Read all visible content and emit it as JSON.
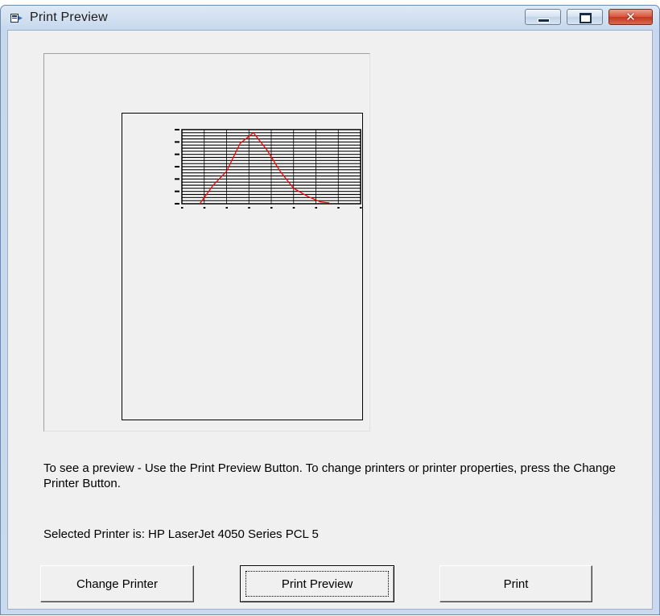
{
  "window": {
    "title": "Print Preview"
  },
  "messages": {
    "info": "To see a preview - Use the Print Preview Button. To change printers or printer properties, press the Change Printer Button.",
    "selected_printer": "Selected Printer is: HP LaserJet 4050 Series PCL 5"
  },
  "buttons": {
    "change_printer": "Change Printer",
    "print_preview": "Print Preview",
    "print": "Print"
  },
  "icons": {
    "app": "print-preview-app-icon",
    "minimize": "minimize-icon",
    "maximize": "maximize-icon",
    "close": "close-icon"
  },
  "colors": {
    "series": "#ff0000",
    "close_button": "#c9432a"
  },
  "chart_data": {
    "type": "line",
    "grid": true,
    "series": [
      {
        "values": [
          [
            8,
            0
          ],
          [
            14,
            1200
          ],
          [
            20,
            2100
          ],
          [
            26,
            3900
          ],
          [
            32,
            4600
          ],
          [
            38,
            3500
          ],
          [
            44,
            2100
          ],
          [
            50,
            1000
          ],
          [
            56,
            500
          ],
          [
            62,
            120
          ],
          [
            66,
            50
          ]
        ]
      }
    ],
    "xlim": [
      0,
      80
    ],
    "ylim": [
      0,
      4800
    ]
  }
}
